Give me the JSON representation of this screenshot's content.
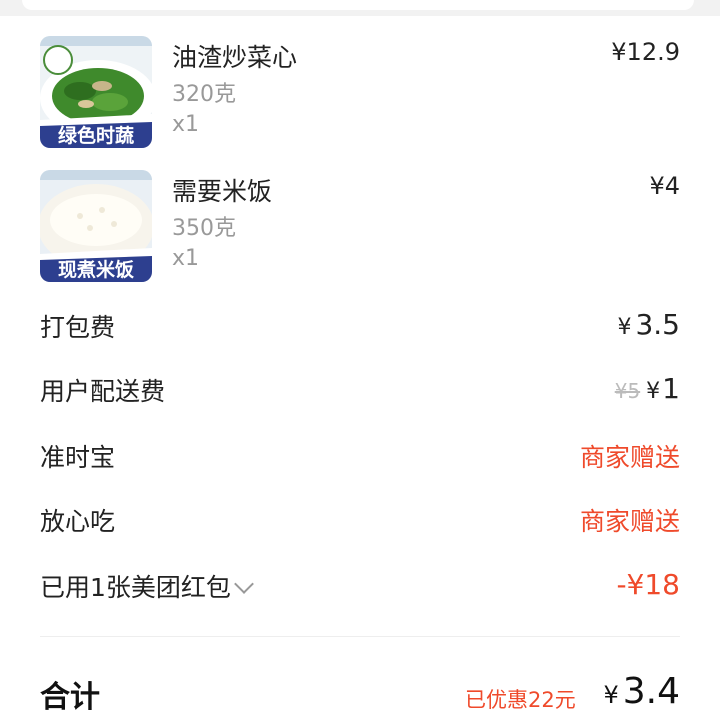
{
  "items": [
    {
      "name": "油渣炒菜心",
      "spec": "320克",
      "qty": "x1",
      "price": "¥12.9",
      "badge": "绿色时蔬"
    },
    {
      "name": "需要米饭",
      "spec": "350克",
      "qty": "x1",
      "price": "¥4",
      "badge": "现煮米饭"
    }
  ],
  "fees": {
    "packing": {
      "label": "打包费",
      "currency": "¥",
      "value": "3.5"
    },
    "delivery": {
      "label": "用户配送费",
      "original": "¥5",
      "currency": "¥",
      "value": "1"
    },
    "ontime": {
      "label": "准时宝",
      "value": "商家赠送"
    },
    "safe": {
      "label": "放心吃",
      "value": "商家赠送"
    },
    "coupon": {
      "label": "已用1张美团红包",
      "value": "-¥18"
    }
  },
  "total": {
    "label": "合计",
    "saved": "已优惠22元",
    "currency": "¥",
    "value": "3.4"
  },
  "colors": {
    "accent": "#ef4a2b",
    "muted": "#999999"
  }
}
